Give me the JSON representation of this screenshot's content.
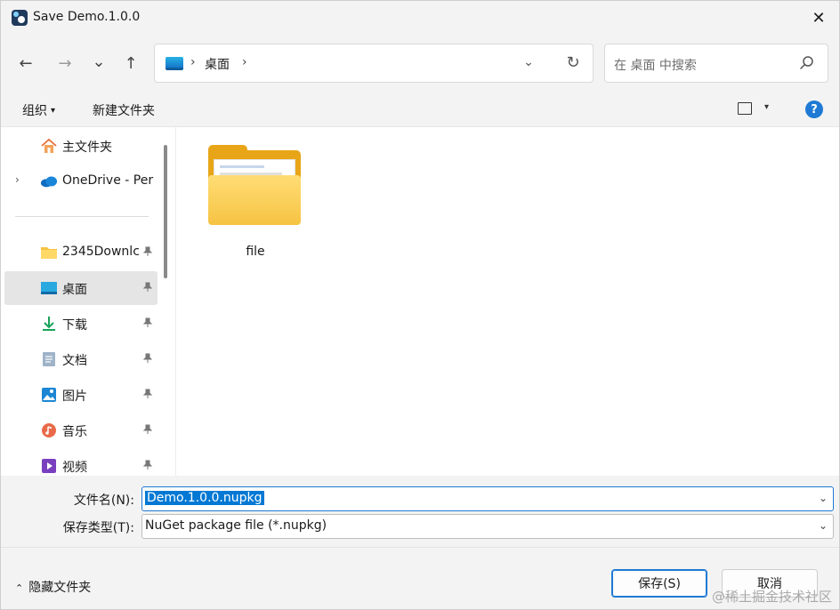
{
  "titlebar": {
    "title": "Save Demo.1.0.0",
    "close_glyph": "✕",
    "app_icon": "app-logo-icon"
  },
  "navigation": {
    "back_glyph": "←",
    "forward_glyph": "→",
    "recent_glyph": "⌄",
    "up_glyph": "↑",
    "address": {
      "location_label": "桌面",
      "separator": "›",
      "dropdown_glyph": "⌄",
      "refresh_glyph": "↻"
    },
    "search": {
      "placeholder": "在 桌面 中搜索"
    }
  },
  "commandbar": {
    "organize_label": "组织",
    "organize_caret": "▾",
    "new_folder_label": "新建文件夹",
    "view_caret": "▾",
    "help_glyph": "?"
  },
  "sidebar": {
    "items": [
      {
        "label": "主文件夹",
        "icon": "home-icon"
      },
      {
        "label": "OneDrive - Per",
        "icon": "onedrive-cloud-icon",
        "expander": "›"
      },
      {
        "label": "2345Downlc",
        "icon": "folder-icon",
        "pinned": true
      },
      {
        "label": "桌面",
        "icon": "desktop-icon",
        "pinned": true,
        "selected": true
      },
      {
        "label": "下载",
        "icon": "download-icon",
        "pinned": true
      },
      {
        "label": "文档",
        "icon": "document-icon",
        "pinned": true
      },
      {
        "label": "图片",
        "icon": "pictures-icon",
        "pinned": true
      },
      {
        "label": "音乐",
        "icon": "music-icon",
        "pinned": true
      },
      {
        "label": "视频",
        "icon": "video-icon",
        "pinned": true
      }
    ],
    "pin_glyph": "📌"
  },
  "content": {
    "files": [
      {
        "name": "file",
        "type": "folder"
      }
    ]
  },
  "fields": {
    "filename_label": "文件名(N):",
    "filename_value": "Demo.1.0.0.nupkg",
    "filetype_label": "保存类型(T):",
    "filetype_value": "NuGet package file (*.nupkg)",
    "dropdown_glyph": "⌄"
  },
  "footer": {
    "hide_folders_caret": "⌃",
    "hide_folders_label": "隐藏文件夹",
    "save_label": "保存(S)",
    "cancel_label": "取消"
  },
  "watermark": "@稀土掘金技术社区",
  "colors": {
    "accent": "#1e7ad4",
    "selection": "#0078d4",
    "folder": "#f6c343"
  }
}
